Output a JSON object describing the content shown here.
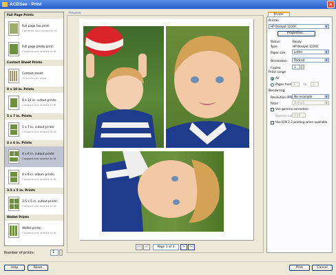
{
  "window": {
    "title": "ACDSee - Print",
    "close_glyph": "×"
  },
  "left_panel": {
    "groups": [
      {
        "heading": "Full Page Prints",
        "items": [
          {
            "title": "Full page fax print:",
            "subtitle": "Centered and rotated to fit"
          },
          {
            "title": "Full page photo print:",
            "subtitle": "Cropped and rotated to fit"
          }
        ]
      },
      {
        "heading": "Contact Sheet Prints",
        "items": [
          {
            "title": "Contact sheet:",
            "subtitle": "35 prints per page"
          }
        ]
      },
      {
        "heading": "8 x 10 in. Prints",
        "items": [
          {
            "title": "8 x 10 in. cutout prints:",
            "subtitle": "Cropped and rotated to fit"
          }
        ]
      },
      {
        "heading": "5 x 7 in. Prints",
        "items": [
          {
            "title": "5 x 7 in. cutout prints:",
            "subtitle": "Cropped and rotated to fit"
          }
        ]
      },
      {
        "heading": "4 x 6 in. Prints",
        "items": [
          {
            "title": "4 x 6 in. cutout prints:",
            "subtitle": "Cropped and rotated to fit",
            "selected": true
          },
          {
            "title": "4 x 6 in. album prints:",
            "subtitle": "Cropped and rotated to fit"
          }
        ]
      },
      {
        "heading": "3.5 x 5 in. Prints",
        "items": [
          {
            "title": "3.5 x 5 in. cutout prints:",
            "subtitle": "Cropped and rotated to fit"
          }
        ]
      },
      {
        "heading": "Wallet Prints",
        "items": [
          {
            "title": "Wallet prints:",
            "subtitle": "Cropped and rotated to fit"
          }
        ]
      }
    ],
    "number_of_prints_label": "Number of prints:",
    "number_of_prints_value": "1"
  },
  "preview": {
    "label": "Preview",
    "page_indicator": "Page 1 of 2",
    "nav": {
      "first": "|<",
      "prev": "<",
      "next": ">",
      "last": ">|"
    }
  },
  "printer_options": {
    "tab_label": "Printer Options",
    "printer_section": "Printer",
    "printer_name": "HP DeskJet 1220C",
    "properties_button": "Properties...",
    "status_label": "Status:",
    "status_value": "Ready",
    "type_label": "Type:",
    "type_value": "HP DeskJet 1220C",
    "paper_size_label": "Paper size:",
    "paper_size_value": "Letter",
    "orientation_label": "Orientation:",
    "orientation_value": "Portrait",
    "copies_label": "Copies:",
    "copies_value": "1",
    "print_range_section": "Print range",
    "all_label": "All",
    "pages_from_label": "Pages from:",
    "pages_from_value": "1",
    "to_label": "to",
    "to_value": "1",
    "rendering_section": "Rendering",
    "resolution_label": "Resolution (PPI):",
    "resolution_value": "No resample",
    "filter_label": "Filter:",
    "filter_value": "Default",
    "gamma_label": "Use gamma correction:",
    "gamma_value_label": "Gamma value:",
    "gamma_value": "1.20",
    "icm_label": "Use ICM 2.2 printing when available"
  },
  "footer": {
    "help": "Help",
    "reset": "Reset",
    "print": "Print",
    "cancel": "Cancel"
  },
  "colors": {
    "title_bar": "#2a5fcc",
    "selected_item": "#c1c4d2",
    "accent_tab": "#f0a82c"
  }
}
